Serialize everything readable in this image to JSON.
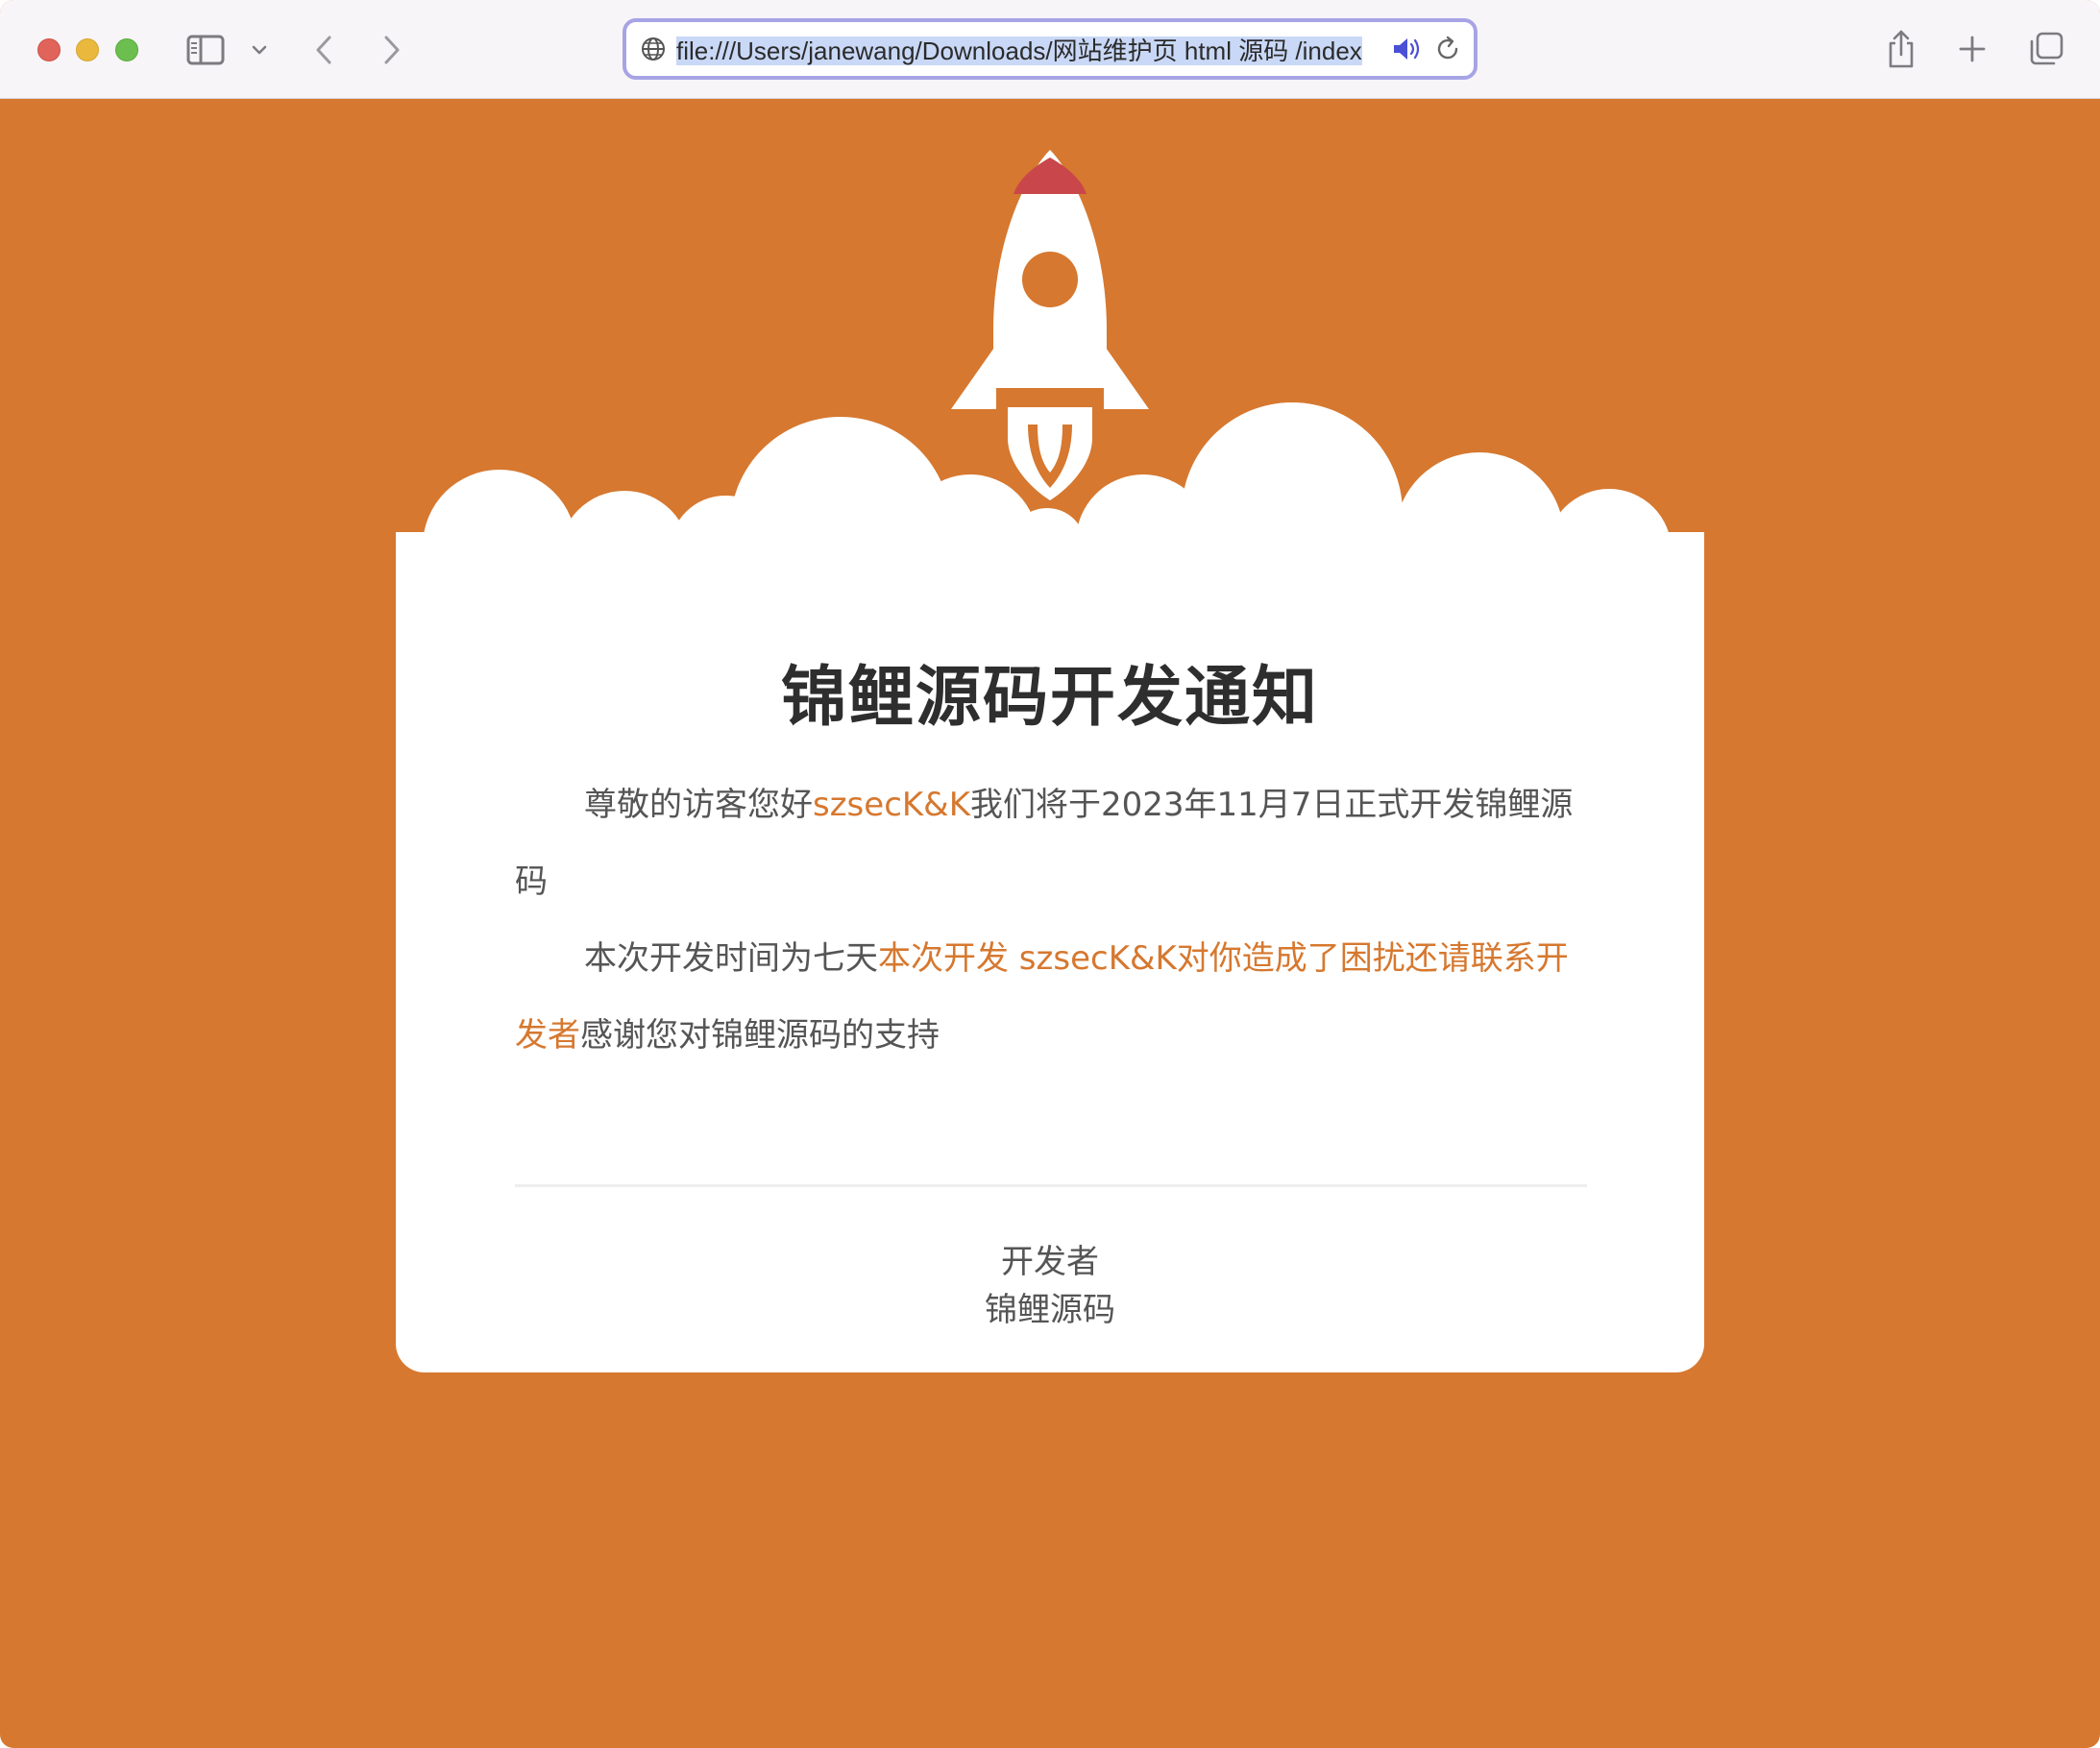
{
  "browser": {
    "url": "file:///Users/janewang/Downloads/网站维护页 html 源码 /index"
  },
  "colors": {
    "accent": "#d6782f",
    "rocket_tip": "#c9474a",
    "text": "#555555",
    "title": "#2e2e2e"
  },
  "notice": {
    "title": "锦鲤源码开发通知",
    "para1_prefix": "尊敬的访客您好",
    "para1_name": "szsecK&K",
    "para1_suffix": "我们将于2023年11月7日正式开发锦鲤源码",
    "para2_prefix": "本次开发时间为七天",
    "para2_highlight": "本次开发 szsecK&K对你造成了困扰还请联系开发者",
    "para2_suffix": "感谢您对锦鲤源码的支持",
    "signature_role": "开发者",
    "signature_name": "锦鲤源码"
  }
}
